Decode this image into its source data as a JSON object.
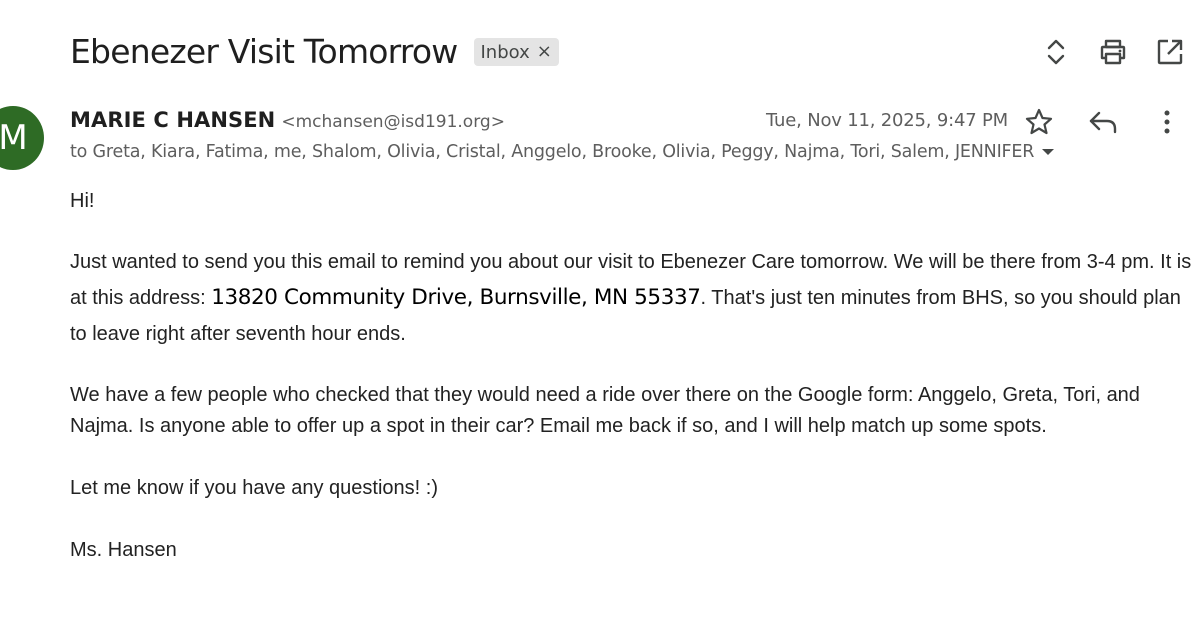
{
  "email": {
    "subject": "Ebenezer Visit Tomorrow",
    "label": "Inbox",
    "label_remove": "×",
    "sender": {
      "initial": "M",
      "name": "MARIE C HANSEN",
      "email": "<mchansen@isd191.org>",
      "avatar_color": "#2e6b25"
    },
    "date": "Tue, Nov 11, 2025, 9:47 PM",
    "recipients": "to Greta, Kiara, Fatima, me, Shalom, Olivia, Cristal, Anggelo, Brooke, Olivia, Peggy, Najma, Tori, Salem, JENNIFER",
    "body": {
      "greeting": "Hi!",
      "p1_a": "Just wanted to send you this email to remind you about our visit to Ebenezer Care tomorrow.  We will be there from 3-4 pm.  It is at this address: ",
      "p1_address": "13820 Community Drive, Burnsville, MN 55337",
      "p1_b": ".  That's just ten minutes from BHS, so you should plan to leave right after seventh hour ends.",
      "p2": "We have a few people who checked that they would need a ride over there on the Google form: Anggelo, Greta, Tori, and Najma.  Is anyone able to offer up a spot in their car?  Email me back if so, and I will help match up some spots.",
      "p3": "Let me know if you have any questions! :)",
      "signature": "Ms. Hansen"
    }
  },
  "icons": {
    "expand": "unfold-icon",
    "print": "print-icon",
    "open_new": "open-in-new-window-icon",
    "star": "star-icon",
    "reply": "reply-icon",
    "more": "more-vertical-icon",
    "recipients_dropdown": "dropdown-arrow-icon"
  },
  "colors": {
    "text": "#1f1f1f",
    "muted": "#5e5e5e",
    "chip_bg": "#e4e4e4",
    "icon": "#444746"
  }
}
